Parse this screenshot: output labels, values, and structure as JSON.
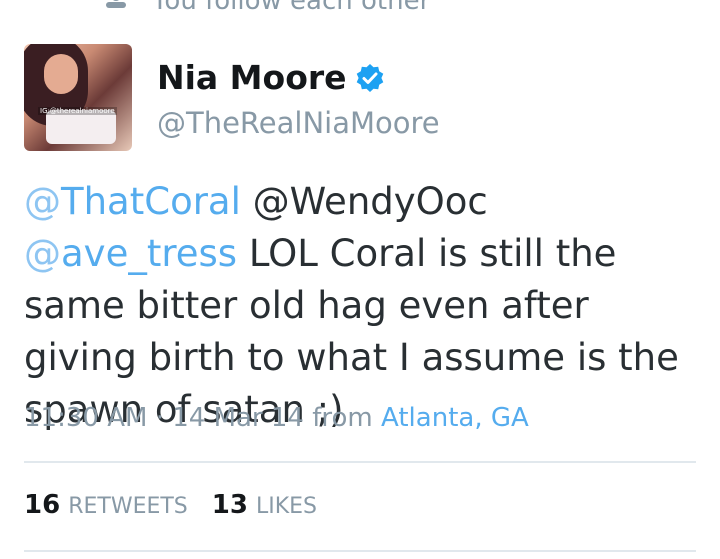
{
  "context": {
    "text": "You follow each other"
  },
  "user": {
    "display_name": "Nia Moore",
    "handle": "@TheRealNiaMoore",
    "verified": true,
    "avatar_watermark": "IG:@therealniamoore"
  },
  "tweet": {
    "mention_1": "ThatCoral",
    "mention_2": "@WendyOoc",
    "mention_3": "ave_tress",
    "body": "LOL Coral is still the same bitter old hag even after giving birth to what I assume is the spawn of satan ;)"
  },
  "meta": {
    "time": "11:30 AM",
    "separator": "·",
    "date": "14 Mar 14",
    "from_label": "from",
    "location": "Atlanta, GA"
  },
  "stats": {
    "retweets_count": "16",
    "retweets_label": "RETWEETS",
    "likes_count": "13",
    "likes_label": "LIKES"
  },
  "colors": {
    "link": "#55acee",
    "muted": "#8899a6",
    "verified": "#1da1f2"
  },
  "icons": {
    "context": "person-icon",
    "verified": "verified-badge-icon"
  }
}
